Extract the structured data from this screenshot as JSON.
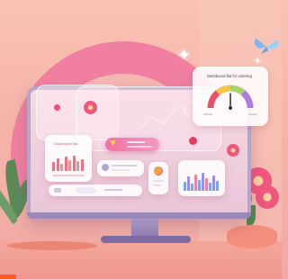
{
  "gauge_card": {
    "title": "Dashboard flat for ordering",
    "colors": [
      "#e9506a",
      "#f7c24a",
      "#a6d36a",
      "#b07be0"
    ],
    "needle_color": "#3a3a3a"
  },
  "left_chart_card": {
    "title": "Dashboard flat",
    "bar_color": "#f0707f"
  },
  "notification_pill": {
    "heart_icon": "heart-icon"
  },
  "accent_colors": {
    "brand_pink": "#f07fa1",
    "monitor_frame": "#b6a5c9",
    "stand": "#8e7ab0"
  }
}
